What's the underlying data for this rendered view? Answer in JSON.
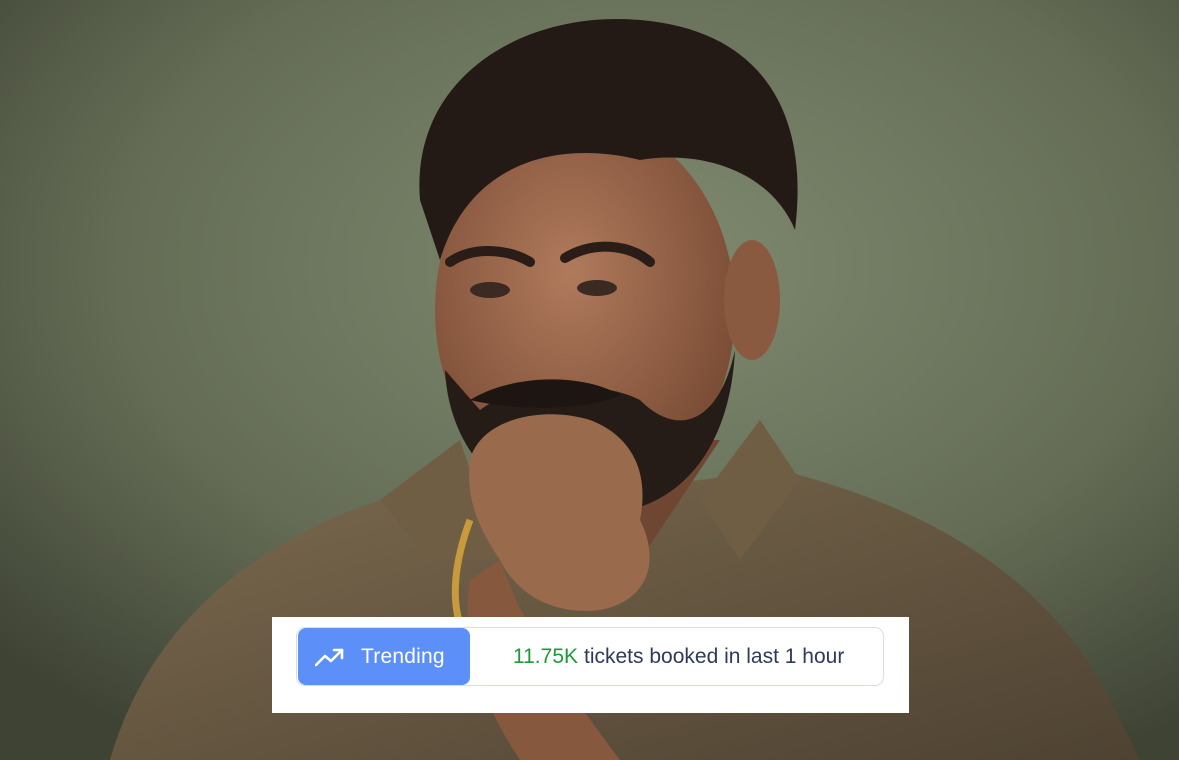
{
  "banner": {
    "badge_label": "Trending",
    "badge_icon": "trending-up-icon",
    "count": "11.75K",
    "message": "tickets booked in last 1 hour"
  },
  "colors": {
    "badge_bg": "#5c8ff7",
    "count_text": "#1d9a3a",
    "message_text": "#2f3a5a",
    "background": "#5f6652"
  }
}
